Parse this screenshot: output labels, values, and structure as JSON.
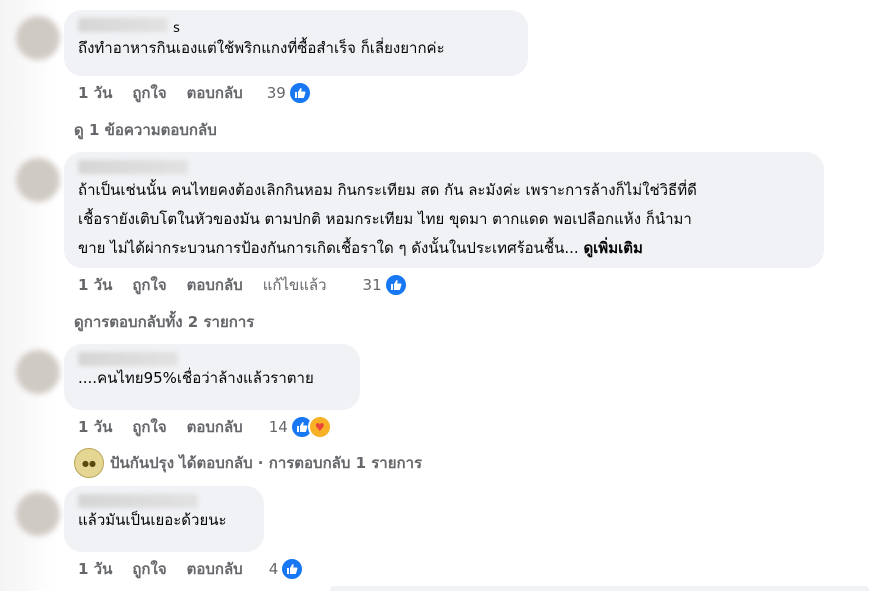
{
  "comments": [
    {
      "text": "ถึงทำอาหารกินเองแต่ใช้พริกแกงที่ซื้อสำเร็จ ก็เลี่ยงยากค่ะ",
      "author_visible": "s",
      "time": "1 วัน",
      "like_label": "ถูกใจ",
      "reply_label": "ตอบกลับ",
      "reaction_count": "39"
    },
    {
      "text": "ถ้าเป็นเช่นนั้น คนไทยคงต้องเลิกกินหอม กินกระเทียม สด กัน ละมังค่ะ เพราะการล้างก็ไม่ใช่วิธีที่ดี\nเชื้อรายังเติบโตในหัวของมัน ตามปกติ หอมกระเทียม ไทย ขุดมา ตากแดด พอเปลือกแห้ง ก็นำมา\nขาย ไม่ได้ผ่ากระบวนการป้องกันการเกิดเชื้อราใด ๆ ดังนั้นในประเทศร้อนชื้น...",
      "see_more": "ดูเพิ่มเติม",
      "time": "1 วัน",
      "like_label": "ถูกใจ",
      "reply_label": "ตอบกลับ",
      "edited_label": "แก้ไขแล้ว",
      "reaction_count": "31"
    },
    {
      "text": "....คนไทย95%เชื่อว่าล้างแล้วราตาย",
      "time": "1 วัน",
      "like_label": "ถูกใจ",
      "reply_label": "ตอบกลับ",
      "reaction_count": "14"
    },
    {
      "text": "แล้วมันเป็นเยอะด้วยนะ",
      "time": "1 วัน",
      "like_label": "ถูกใจ",
      "reply_label": "ตอบกลับ",
      "reaction_count": "4"
    }
  ],
  "view_reply_1": "ดู 1 ข้อความตอบกลับ",
  "view_replies_2": "ดูการตอบกลับทั้ง 2 รายการ",
  "reply_summary": "ปันกันปรุง ได้ตอบกลับ · การตอบกลับ 1 รายการ",
  "colors": {
    "bubble": "#f0f2f5",
    "like_blue": "#1877f2",
    "muted": "#65676b"
  }
}
